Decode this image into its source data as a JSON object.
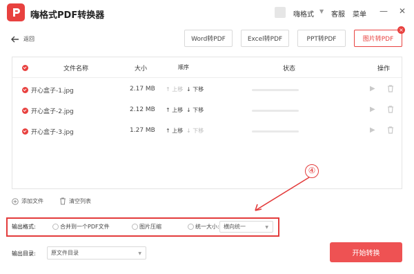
{
  "app": {
    "title": "嗨格式PDF转换器",
    "user_name": "嗨格式",
    "links": {
      "support": "客服",
      "menu": "菜单"
    }
  },
  "colors": {
    "accent": "#e8413f",
    "button": "#ee5253",
    "annotation": "#e33b3b"
  },
  "nav": {
    "back_label": "返回"
  },
  "tabs": [
    {
      "label": "Word转PDF",
      "active": false
    },
    {
      "label": "Excel转PDF",
      "active": false
    },
    {
      "label": "PPT转PDF",
      "active": false
    },
    {
      "label": "图片转PDF",
      "active": true
    }
  ],
  "table": {
    "headers": {
      "name": "文件名称",
      "size": "大小",
      "order": "顺序",
      "status": "状态",
      "action": "操作"
    },
    "rows": [
      {
        "name": "开心盒子-1.jpg",
        "size": "2.17 MB",
        "up": "上移",
        "down": "下移"
      },
      {
        "name": "开心盒子-2.jpg",
        "size": "2.12 MB",
        "up": "上移",
        "down": "下移"
      },
      {
        "name": "开心盒子-3.jpg",
        "size": "1.27 MB",
        "up": "上移",
        "down": "下移"
      }
    ]
  },
  "file_actions": {
    "add": "添加文件",
    "clear": "清空列表"
  },
  "annotation": {
    "number": "④"
  },
  "output_format": {
    "label": "输出格式:",
    "options": [
      "合并到一个PDF文件",
      "图片压缩",
      "统一大小:"
    ],
    "size_select_value": "横向统一"
  },
  "output_dir": {
    "label": "输出目录:",
    "value": "原文件目录"
  },
  "start_button": "开始转换"
}
